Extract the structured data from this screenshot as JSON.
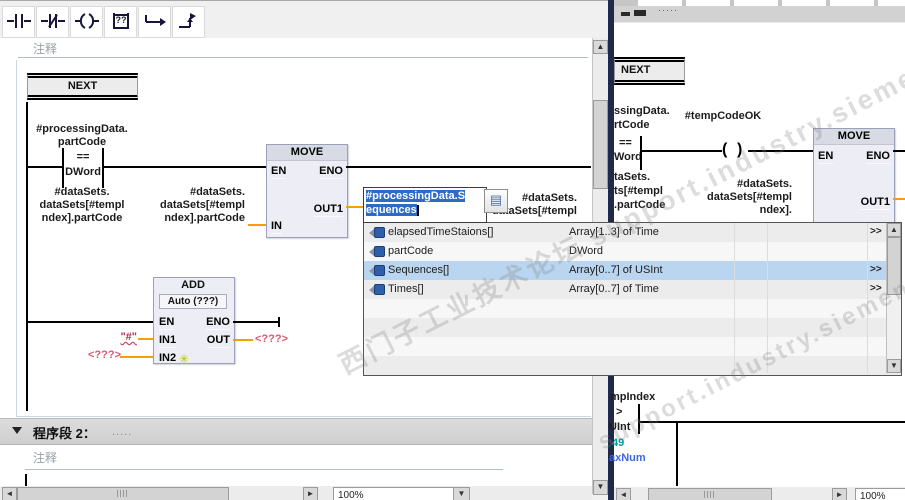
{
  "left_toolbar": {
    "empty_box_glyph": "??",
    "buttons": [
      "no-contact",
      "nc-contact",
      "coil",
      "empty-box",
      "open-branch",
      "close-branch"
    ]
  },
  "left_editor": {
    "comment1": "注释",
    "network1": {
      "jump_label": "NEXT",
      "compare": {
        "top1": "#processingData.",
        "top2": "partCode",
        "operator": "==",
        "datatype": "DWord",
        "bottom1": "#dataSets.",
        "bottom2": "dataSets[#templ",
        "bottom3": "ndex].partCode"
      },
      "move": {
        "title": "MOVE",
        "en": "EN",
        "eno": "ENO",
        "out1": "OUT1",
        "in": "IN"
      },
      "move_in_operand": {
        "l1": "#dataSets.",
        "l2": "dataSets[#templ",
        "l3": "ndex].partCode"
      },
      "partial_operand": {
        "l1": "#dataSets.",
        "l2": "dataSets[#templ"
      },
      "add": {
        "title": "ADD",
        "mode": "Auto (???)",
        "en": "EN",
        "eno": "ENO",
        "in1": "IN1",
        "in2": "IN2",
        "out": "OUT",
        "add_input_star": "✳"
      },
      "add_in1": "\"#\"",
      "add_in2": "<???>",
      "add_out": "<???>"
    },
    "network2": {
      "collapse": "▼",
      "title": "程序段 2：",
      "dots": ".....",
      "comment": "注释"
    },
    "zoom_value": "100%"
  },
  "autocomplete": {
    "editor_line1": "#processingData.S",
    "editor_line2": "equences",
    "button_glyph": "▤",
    "rows": [
      {
        "name": "elapsedTimeStaions[]",
        "type": "Array[1..3] of Time",
        "more": ">>"
      },
      {
        "name": "partCode",
        "type": "DWord",
        "more": ""
      },
      {
        "name": "Sequences[]",
        "type": "Array[0..7] of USInt",
        "more": ">>"
      },
      {
        "name": "Times[]",
        "type": "Array[0..7] of Time",
        "more": ">>"
      }
    ]
  },
  "right_editor": {
    "header_dots": "·····",
    "jump_label": "NEXT",
    "compare": {
      "top1": "ssingData.",
      "top2": "rtCode",
      "operator": "==",
      "datatype": "Word",
      "bottom1": "taSets.",
      "bottom2": "ts[#templ",
      "bottom3": ".partCode"
    },
    "coil_operand": "#tempCodeOK",
    "coil_left": "(",
    "coil_right": ")",
    "move": {
      "title": "MOVE",
      "en": "EN",
      "eno": "ENO",
      "out1": "OUT1"
    },
    "move_in_operand": {
      "l1": "#dataSets.",
      "l2": "dataSets[#templ",
      "l3": "ndex]."
    },
    "compare2": {
      "top": "mpIndex",
      "operator": ">",
      "datatype": "UInt",
      "value": "49",
      "tag": "axNum"
    },
    "zoom_value": "100%"
  },
  "watermark": {
    "line1": "西门子工业技术论坛 support.industry.siemens.com",
    "line2": "support.industry.siemens"
  }
}
